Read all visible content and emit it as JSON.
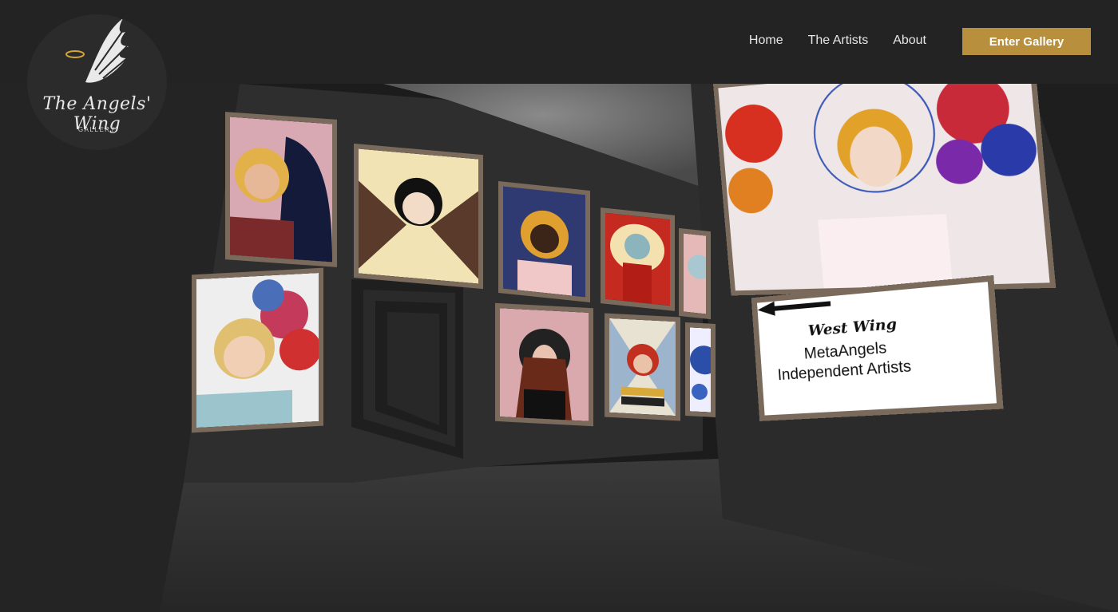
{
  "brand": {
    "name": "The Angels' Wing",
    "subtitle": "GALLERY"
  },
  "nav": {
    "items": [
      "Home",
      "The Artists",
      "About"
    ],
    "cta": "Enter Gallery"
  },
  "colors": {
    "header_bg": "#232323",
    "accent_gold": "#b8903d",
    "frame": "#7a6a5c"
  },
  "sign": {
    "title": "West Wing",
    "line1": "MetaAngels",
    "line2": "Independent Artists",
    "icon": "arrow-left-icon"
  }
}
